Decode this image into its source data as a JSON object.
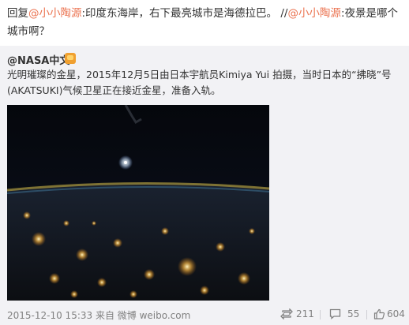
{
  "reply": {
    "prefix": "回复",
    "mention1": "@小小陶源",
    "text1": ":印度东海岸，右下最亮城市是海德拉巴。 //",
    "mention2": "@小小陶源",
    "text2": ":夜景是哪个城市啊？"
  },
  "quoted": {
    "author": "@NASA中文",
    "text": "光明璀璨的金星，2015年12月5日由日本宇航员Kimiya Yui 拍摄，当时日本的“拂晓”号(AKATSUKI)气候卫星正在接近金星，准备入轨。",
    "meta": "2015-12-10 15:33 来自 微博 weibo.com",
    "reposts": "211",
    "comments": "55",
    "likes": "604"
  },
  "icons": [
    "verified-badge-icon",
    "repost-icon",
    "comment-icon",
    "like-icon"
  ],
  "colors": {
    "mention": "#eb7350",
    "quoted_bg": "#f2f2f5",
    "meta_text": "#808080"
  }
}
